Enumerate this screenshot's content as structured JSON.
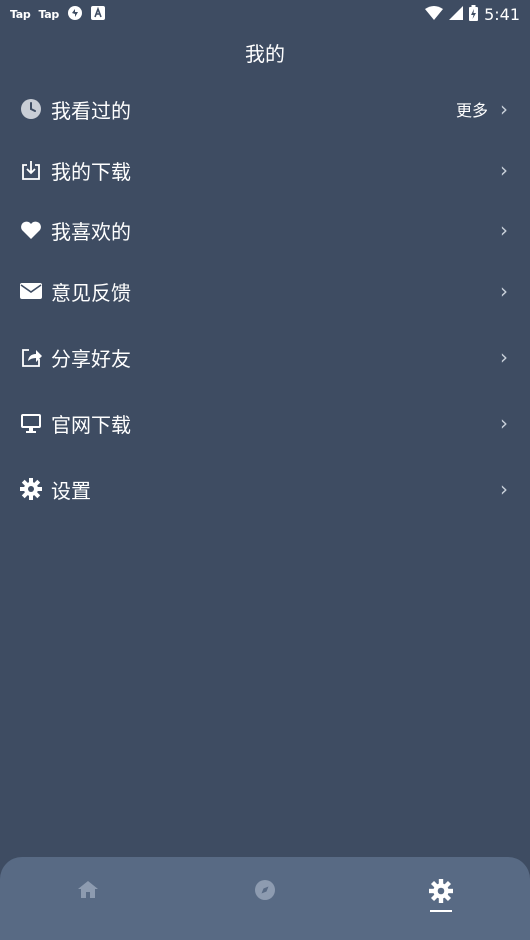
{
  "status_bar": {
    "left_labels": [
      "Tap",
      "Tap"
    ],
    "time": "5:41"
  },
  "header": {
    "title": "我的"
  },
  "menu": {
    "items": [
      {
        "label": "我看过的",
        "more": "更多",
        "icon": "clock-icon"
      },
      {
        "label": "我的下载",
        "more": "",
        "icon": "download-icon"
      },
      {
        "label": "我喜欢的",
        "more": "",
        "icon": "heart-icon"
      },
      {
        "label": "意见反馈",
        "more": "",
        "icon": "mail-icon"
      },
      {
        "label": "分享好友",
        "more": "",
        "icon": "share-icon"
      },
      {
        "label": "官网下载",
        "more": "",
        "icon": "monitor-icon"
      },
      {
        "label": "设置",
        "more": "",
        "icon": "gear-icon"
      }
    ],
    "chevron": "›"
  },
  "tabbar": {
    "tabs": [
      {
        "name": "home",
        "icon": "home-icon",
        "active": false
      },
      {
        "name": "discover",
        "icon": "compass-icon",
        "active": false
      },
      {
        "name": "mine",
        "icon": "gear-icon",
        "active": true
      }
    ],
    "active_color": "#ffffff",
    "inactive_color": "#8d9bb0"
  },
  "colors": {
    "background": "#3e4c62",
    "tabbar": "#586a84"
  }
}
